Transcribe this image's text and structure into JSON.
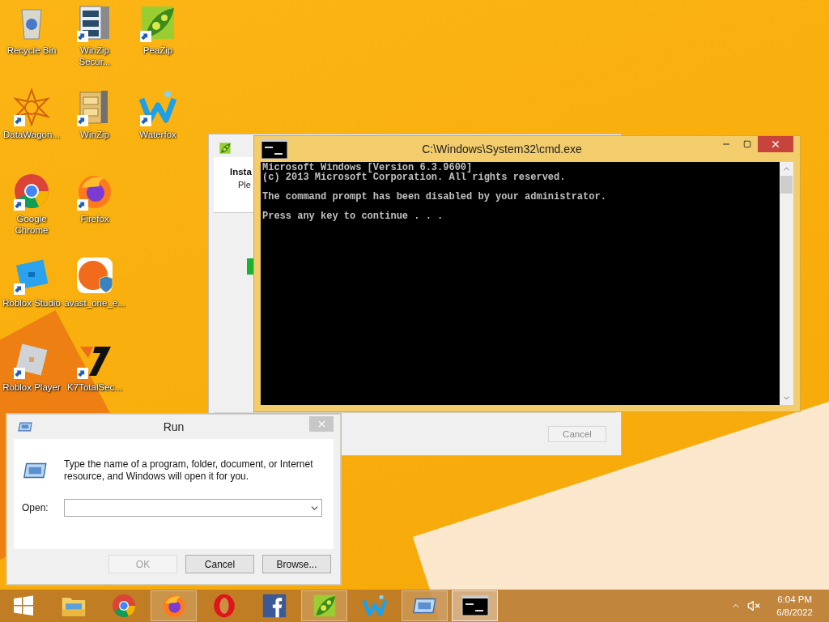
{
  "desktop": {
    "rows": [
      {
        "icons": [
          {
            "label": "Recycle Bin",
            "kind": "recycle",
            "shortcut": false
          },
          {
            "label": "WinZip Secur...",
            "kind": "cabinet",
            "shortcut": true
          },
          {
            "label": "PeaZip",
            "kind": "leaf",
            "shortcut": true
          }
        ]
      },
      {
        "icons": [
          {
            "label": "DataWagon...",
            "kind": "star",
            "shortcut": true
          },
          {
            "label": "WinZip",
            "kind": "clamp",
            "shortcut": true
          },
          {
            "label": "Waterfox",
            "kind": "wave",
            "shortcut": true
          }
        ]
      },
      {
        "icons": [
          {
            "label": "Google Chrome",
            "kind": "chrome",
            "shortcut": true
          },
          {
            "label": "Firefox",
            "kind": "fox",
            "shortcut": true
          }
        ]
      },
      {
        "icons": [
          {
            "label": "Roblox Studio",
            "kind": "tile",
            "shortcut": true
          },
          {
            "label": "avast_one_e...",
            "kind": "avast",
            "shortcut": false
          }
        ]
      },
      {
        "icons": [
          {
            "label": "Roblox Player",
            "kind": "graytile",
            "shortcut": true
          },
          {
            "label": "K7TotalSec...",
            "kind": "k7",
            "shortcut": true
          }
        ]
      }
    ]
  },
  "installer_window": {
    "heading": "Insta",
    "subtext": "Ple",
    "cancel": "Cancel"
  },
  "cmd_window": {
    "title": "C:\\Windows\\System32\\cmd.exe",
    "paragraphs": [
      [
        "Microsoft Windows [Version 6.3.9600]",
        "(c) 2013 Microsoft Corporation. All rights reserved."
      ],
      [
        "The command prompt has been disabled by your administrator."
      ],
      [
        "Press any key to continue . . ."
      ]
    ]
  },
  "run_dialog": {
    "title": "Run",
    "description": "Type the name of a program, folder, document, or Internet resource, and Windows will open it for you.",
    "open_label": "Open:",
    "buttons": [
      {
        "label": "OK",
        "disabled": true
      },
      {
        "label": "Cancel",
        "disabled": false
      },
      {
        "label": "Browse...",
        "disabled": false
      }
    ]
  },
  "taskbar": {
    "items": [
      {
        "kind": "start",
        "running": false,
        "selected": false
      },
      {
        "kind": "folder",
        "running": false,
        "selected": false
      },
      {
        "kind": "chrome",
        "running": false,
        "selected": false
      },
      {
        "kind": "fox",
        "running": true,
        "selected": false
      },
      {
        "kind": "ring",
        "running": false,
        "selected": false
      },
      {
        "kind": "fb",
        "running": false,
        "selected": false
      },
      {
        "kind": "leaf",
        "running": true,
        "selected": false
      },
      {
        "kind": "wave",
        "running": false,
        "selected": false
      },
      {
        "kind": "run",
        "running": true,
        "selected": false
      },
      {
        "kind": "cmd",
        "running": true,
        "selected": true
      }
    ],
    "time": "6:04 PM",
    "date": "6/8/2022"
  }
}
